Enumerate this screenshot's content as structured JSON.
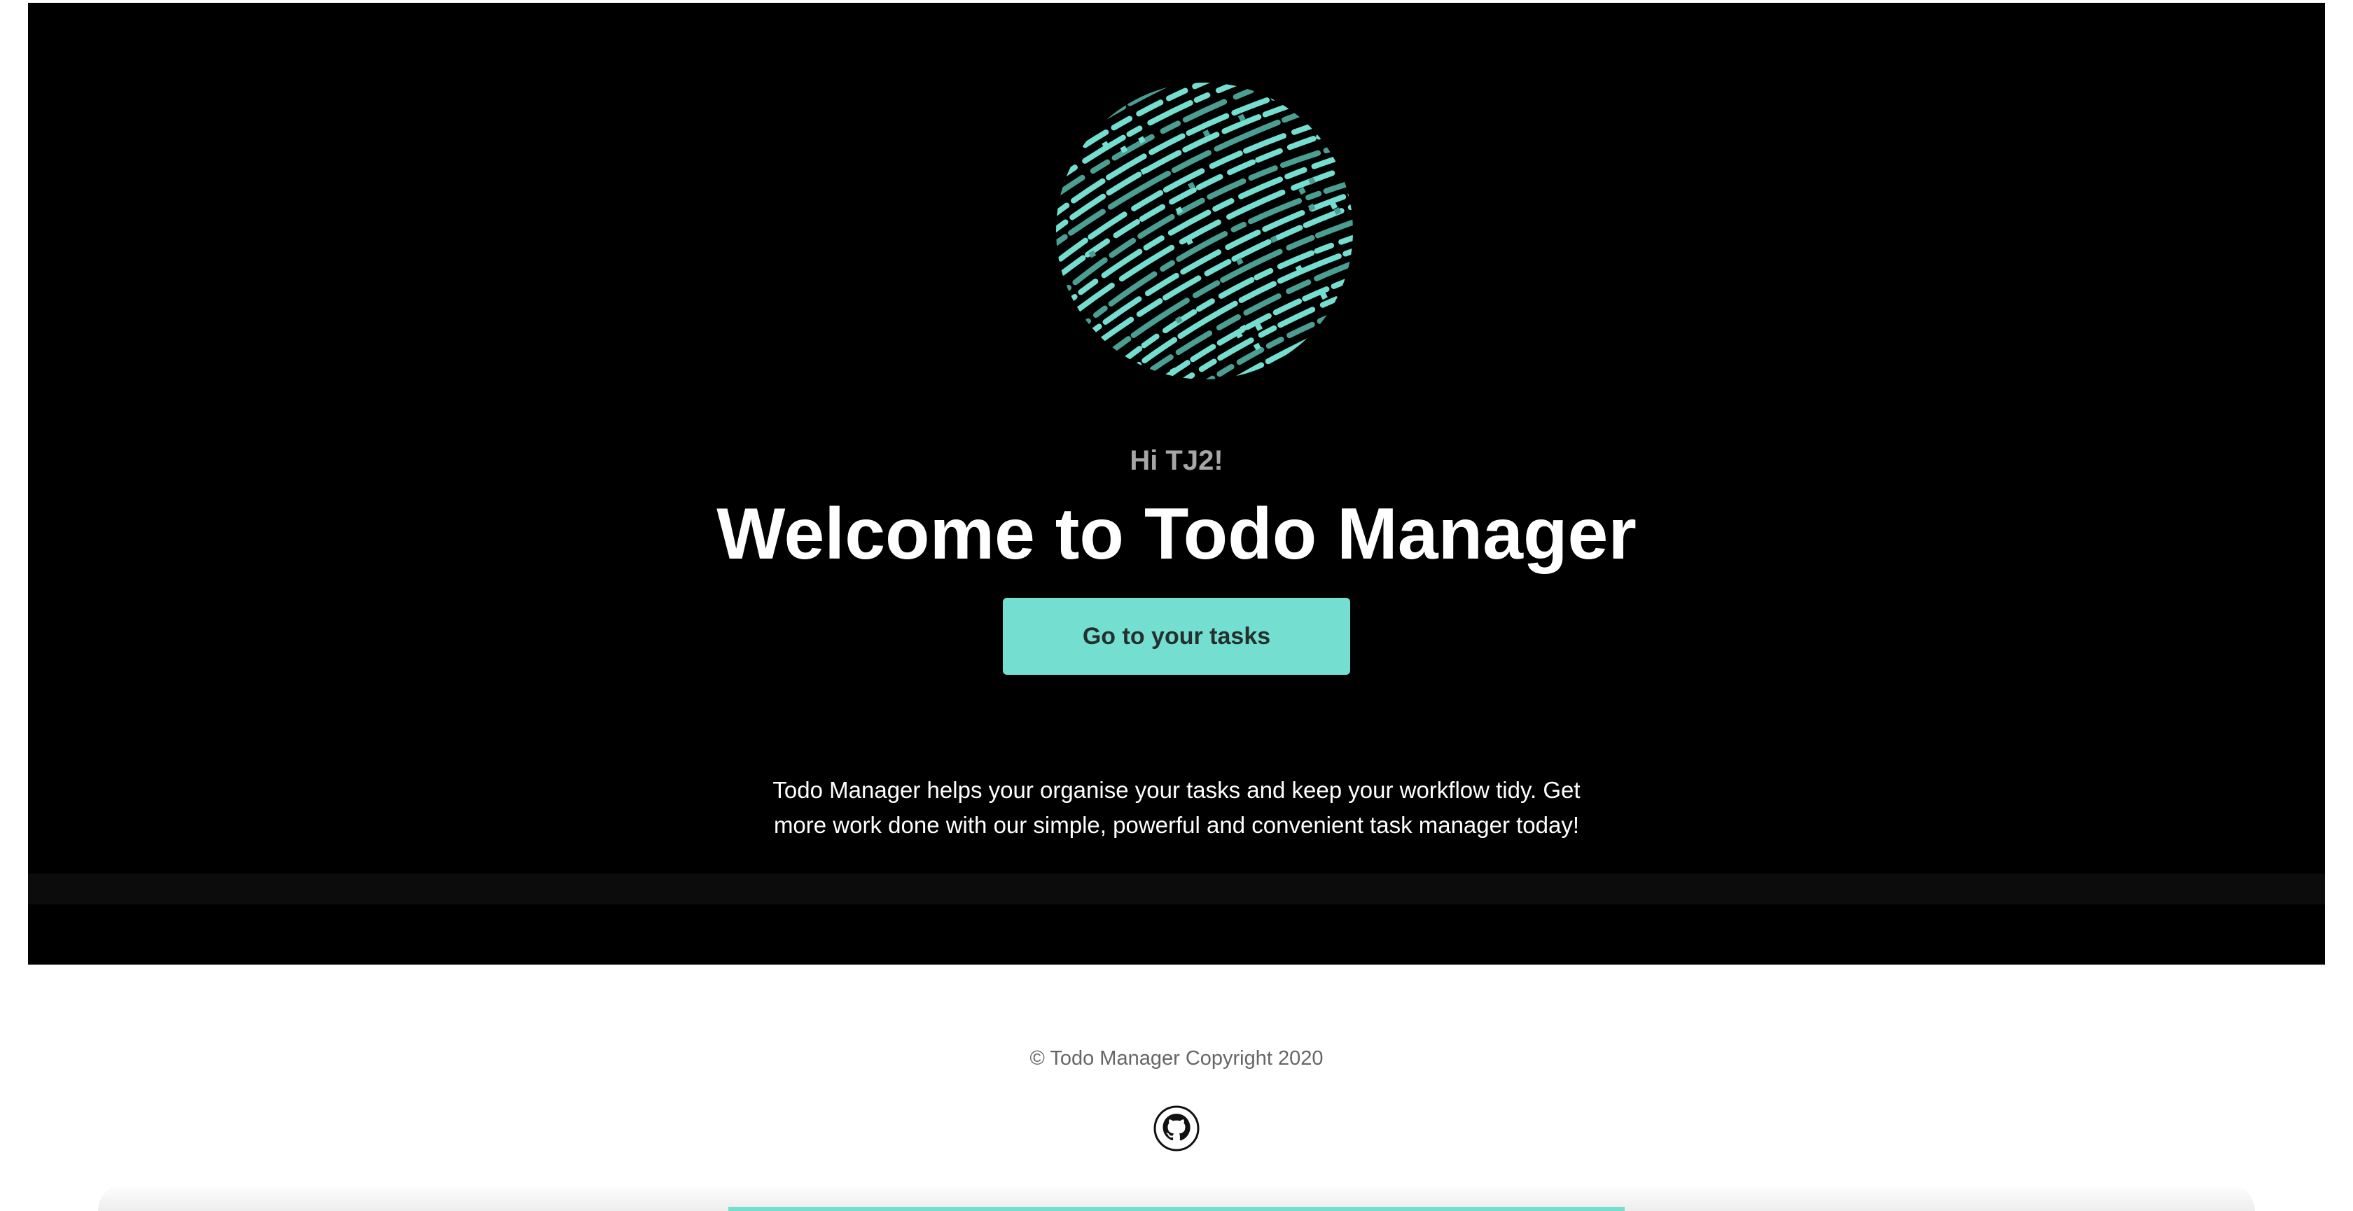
{
  "hero": {
    "greeting": "Hi TJ2!",
    "title": "Welcome to Todo Manager",
    "cta_label": "Go to your tasks",
    "description": "Todo Manager helps your organise your tasks and keep your workflow tidy. Get more work done with our simple, powerful and convenient task manager today!",
    "logo_icon": "fingerprint-icon"
  },
  "footer": {
    "copyright": "© Todo Manager Copyright 2020",
    "github_icon": "github-icon"
  },
  "colors": {
    "background": "#000000",
    "accent": "#74dfd0",
    "accent_dark": "#4a9e92",
    "greeting": "#a6a6a6",
    "footer_text": "#666666"
  }
}
